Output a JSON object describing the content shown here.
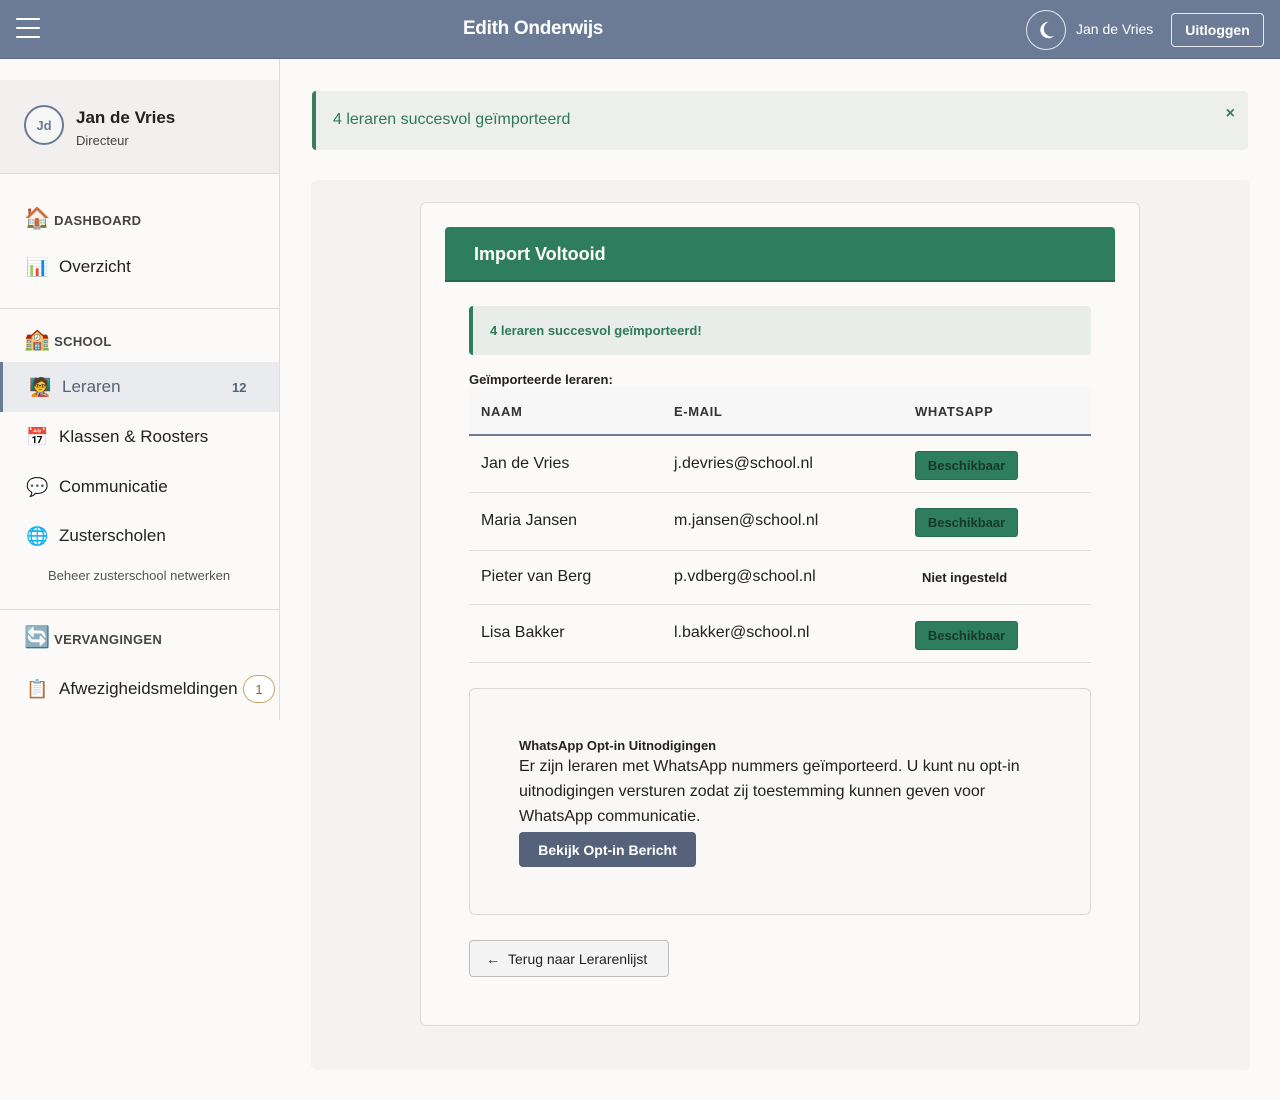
{
  "topbar": {
    "title": "Edith Onderwijs",
    "user_name": "Jan de Vries",
    "logout_label": "Uitloggen",
    "icons": [
      "menu-icon",
      "moon-icon"
    ]
  },
  "sidebar": {
    "profile": {
      "initials": "Jd",
      "name": "Jan de Vries",
      "role": "Directeur"
    },
    "sections": [
      {
        "icon": "🏠",
        "label": "DASHBOARD"
      },
      {
        "icon": "🏫",
        "label": "SCHOOL"
      },
      {
        "icon": "🔄",
        "label": "VERVANGINGEN"
      }
    ],
    "items": [
      {
        "icon": "📊",
        "label": "Overzicht"
      },
      {
        "icon": "🧑‍🏫",
        "label": "Leraren",
        "count": "12"
      },
      {
        "icon": "📅",
        "label": "Klassen & Roosters"
      },
      {
        "icon": "💬",
        "label": "Communicatie"
      },
      {
        "icon": "🌐",
        "label": "Zusterscholen",
        "sub": "Beheer zusterschool netwerken"
      },
      {
        "icon": "📋",
        "label": "Afwezigheidsmeldingen",
        "badge": "1"
      }
    ]
  },
  "main": {
    "alert": "4 leraren succesvol geïmporteerd",
    "alert_close": "×",
    "card_title": "Import Voltooid",
    "inner_alert": "4 leraren succesvol geïmporteerd!",
    "table_caption": "Geïmporteerde leraren:",
    "columns": [
      "NAAM",
      "E-MAIL",
      "WHATSAPP"
    ],
    "rows": [
      {
        "name": "Jan de Vries",
        "email": "j.devries@school.nl",
        "whatsapp": "Beschikbaar",
        "status": "ok"
      },
      {
        "name": "Maria Jansen",
        "email": "m.jansen@school.nl",
        "whatsapp": "Beschikbaar",
        "status": "ok"
      },
      {
        "name": "Pieter van Berg",
        "email": "p.vdberg@school.nl",
        "whatsapp": "Niet ingesteld",
        "status": "none"
      },
      {
        "name": "Lisa Bakker",
        "email": "l.bakker@school.nl",
        "whatsapp": "Beschikbaar",
        "status": "ok"
      }
    ],
    "optin": {
      "title": "WhatsApp Opt-in Uitnodigingen",
      "text": "Er zijn leraren met WhatsApp nummers geïmporteerd. U kunt nu opt-in uitnodigingen versturen zodat zij toestemming kunnen geven voor WhatsApp communicatie.",
      "button": "Bekijk Opt-in Bericht"
    },
    "back_button": "Terug naar Lerarenlijst",
    "back_arrow": "←"
  },
  "colors": {
    "topbar": "#6b7b96",
    "success": "#2e7d5e",
    "accent": "#56627a",
    "badge_border": "#c9a46a"
  }
}
